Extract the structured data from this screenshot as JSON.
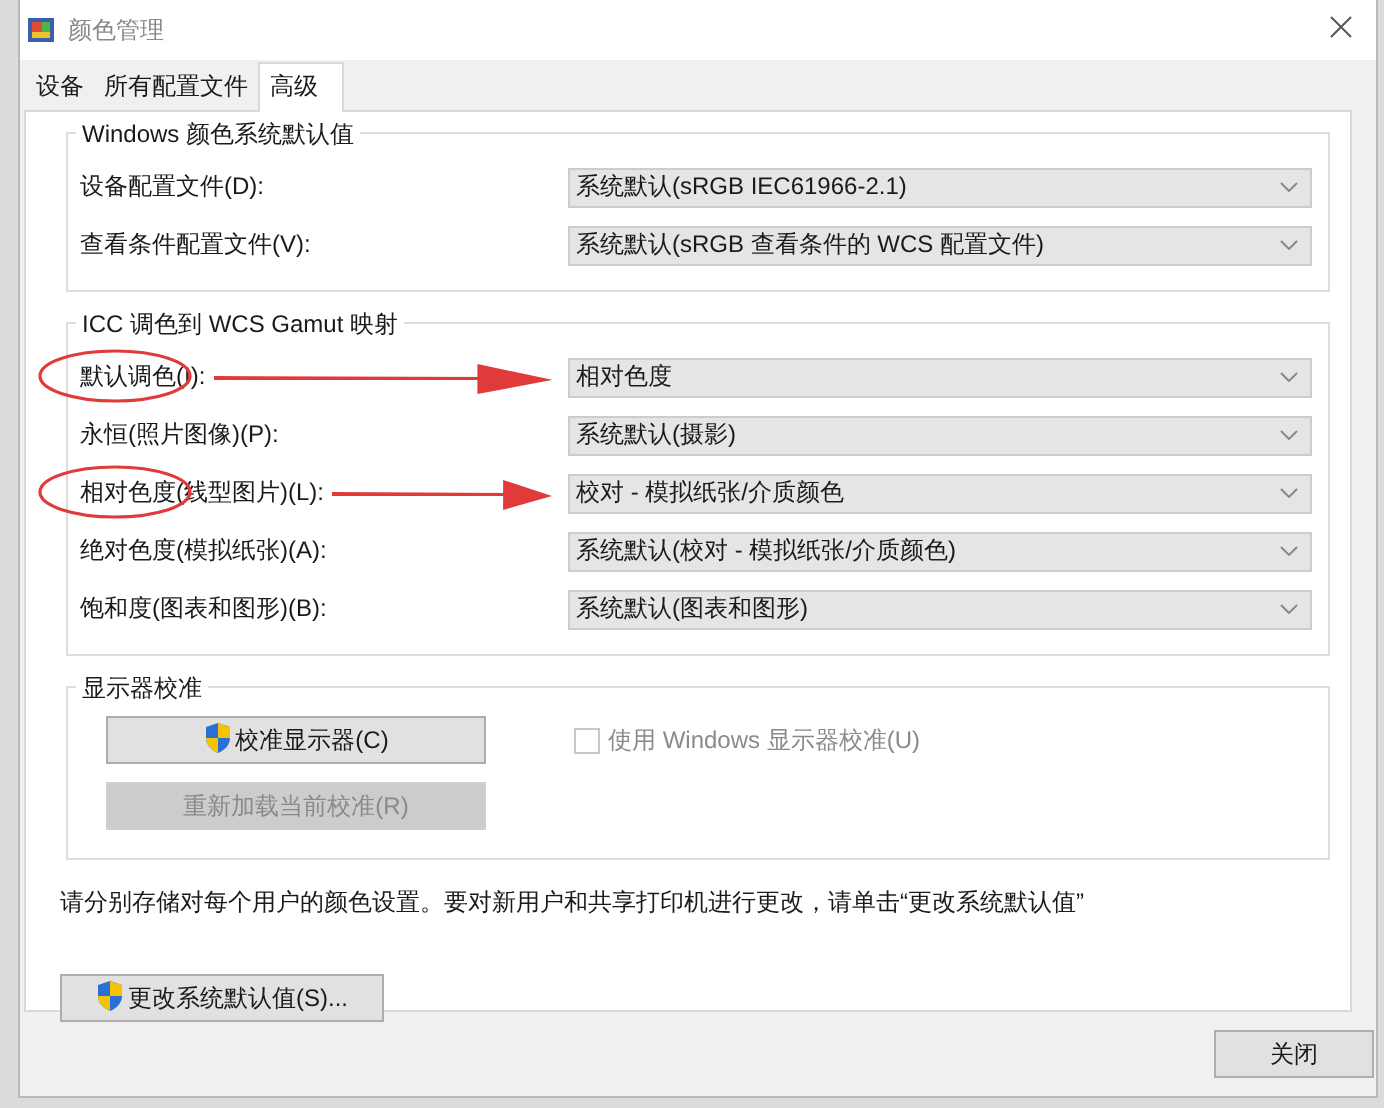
{
  "window": {
    "title": "颜色管理"
  },
  "tabs": [
    {
      "label": "设备",
      "selected": false
    },
    {
      "label": "所有配置文件",
      "selected": false
    },
    {
      "label": "高级",
      "selected": true
    }
  ],
  "groups": [
    {
      "title": "Windows 颜色系统默认值",
      "kind": "combos",
      "rows": [
        {
          "label": "设备配置文件(D):",
          "value": "系统默认(sRGB IEC61966-2.1)",
          "marked": false
        },
        {
          "label": "查看条件配置文件(V):",
          "value": "系统默认(sRGB 查看条件的 WCS 配置文件)",
          "marked": false
        }
      ]
    },
    {
      "title": "ICC 调色到 WCS Gamut 映射",
      "kind": "combos",
      "rows": [
        {
          "label": "默认调色(I):",
          "value": "相对色度",
          "marked": true
        },
        {
          "label": "永恒(照片图像)(P):",
          "value": "系统默认(摄影)",
          "marked": false
        },
        {
          "label": "相对色度(线型图片)(L):",
          "value": "校对 - 模拟纸张/介质颜色",
          "marked": true
        },
        {
          "label": "绝对色度(模拟纸张)(A):",
          "value": "系统默认(校对 - 模拟纸张/介质颜色)",
          "marked": false
        },
        {
          "label": "饱和度(图表和图形)(B):",
          "value": "系统默认(图表和图形)",
          "marked": false
        }
      ]
    },
    {
      "title": "显示器校准",
      "kind": "calibration",
      "buttons": [
        {
          "label": "校准显示器(C)",
          "shield": true,
          "disabled": false
        },
        {
          "label": "重新加载当前校准(R)",
          "shield": false,
          "disabled": true
        }
      ],
      "checkbox": {
        "label": "使用 Windows 显示器校准(U)",
        "checked": false,
        "disabled": true
      }
    }
  ],
  "note": "请分别存储对每个用户的颜色设置。要对新用户和共享打印机进行更改，请单击“更改系统默认值”",
  "default_button": {
    "label": "更改系统默认值(S)...",
    "shield": true
  },
  "close_button": {
    "label": "关闭"
  }
}
